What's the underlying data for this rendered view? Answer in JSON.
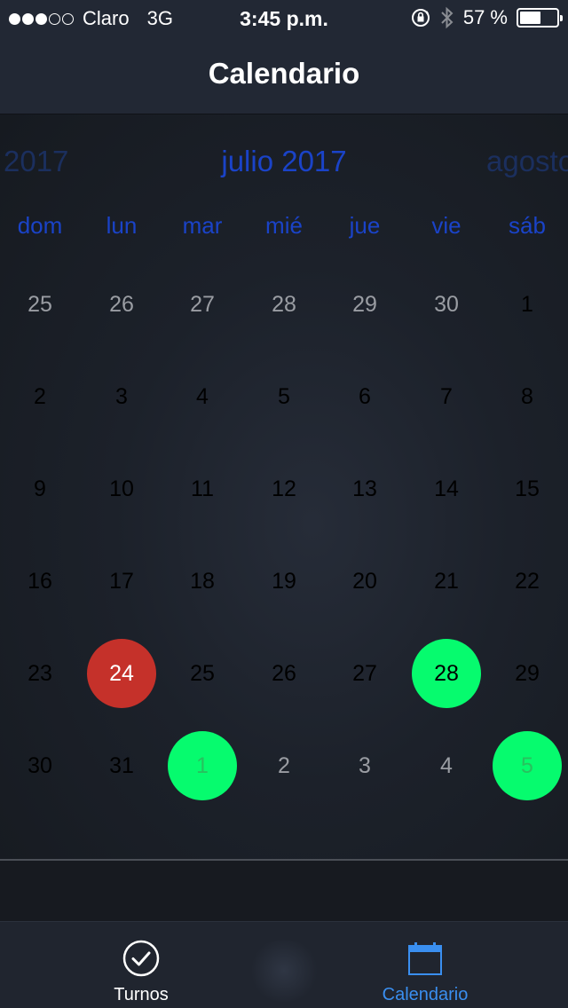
{
  "status_bar": {
    "signal_bars_filled": 3,
    "signal_bars_total": 5,
    "carrier": "Claro",
    "network": "3G",
    "time": "3:45 p.m.",
    "icons": [
      "orientation-lock-icon",
      "bluetooth-icon"
    ],
    "battery_percent_text": "57 %",
    "battery_level": 0.57
  },
  "nav": {
    "title": "Calendario"
  },
  "calendar": {
    "prev_month": "2017",
    "current_month": "julio 2017",
    "next_month": "agosto",
    "weekdays": [
      "dom",
      "lun",
      "mar",
      "mié",
      "jue",
      "vie",
      "sáb"
    ],
    "weeks": [
      [
        {
          "n": "25",
          "t": "outside"
        },
        {
          "n": "26",
          "t": "outside"
        },
        {
          "n": "27",
          "t": "outside"
        },
        {
          "n": "28",
          "t": "outside"
        },
        {
          "n": "29",
          "t": "outside"
        },
        {
          "n": "30",
          "t": "outside"
        },
        {
          "n": "1",
          "t": "normal"
        }
      ],
      [
        {
          "n": "2",
          "t": "normal"
        },
        {
          "n": "3",
          "t": "normal"
        },
        {
          "n": "4",
          "t": "normal"
        },
        {
          "n": "5",
          "t": "normal"
        },
        {
          "n": "6",
          "t": "normal"
        },
        {
          "n": "7",
          "t": "normal"
        },
        {
          "n": "8",
          "t": "normal"
        }
      ],
      [
        {
          "n": "9",
          "t": "normal"
        },
        {
          "n": "10",
          "t": "normal"
        },
        {
          "n": "11",
          "t": "normal"
        },
        {
          "n": "12",
          "t": "normal"
        },
        {
          "n": "13",
          "t": "normal"
        },
        {
          "n": "14",
          "t": "normal"
        },
        {
          "n": "15",
          "t": "normal"
        }
      ],
      [
        {
          "n": "16",
          "t": "normal"
        },
        {
          "n": "17",
          "t": "normal"
        },
        {
          "n": "18",
          "t": "normal"
        },
        {
          "n": "19",
          "t": "normal"
        },
        {
          "n": "20",
          "t": "normal"
        },
        {
          "n": "21",
          "t": "normal"
        },
        {
          "n": "22",
          "t": "normal"
        }
      ],
      [
        {
          "n": "23",
          "t": "normal"
        },
        {
          "n": "24",
          "t": "red"
        },
        {
          "n": "25",
          "t": "normal"
        },
        {
          "n": "26",
          "t": "normal"
        },
        {
          "n": "27",
          "t": "normal"
        },
        {
          "n": "28",
          "t": "green"
        },
        {
          "n": "29",
          "t": "normal"
        }
      ],
      [
        {
          "n": "30",
          "t": "normal"
        },
        {
          "n": "31",
          "t": "normal"
        },
        {
          "n": "1",
          "t": "green-dim"
        },
        {
          "n": "2",
          "t": "outside"
        },
        {
          "n": "3",
          "t": "outside"
        },
        {
          "n": "4",
          "t": "outside"
        },
        {
          "n": "5",
          "t": "green-dim"
        }
      ]
    ],
    "colors": {
      "accent_blue": "#1a43c8",
      "marked_red": "#c5312a",
      "marked_green": "#06fb6e"
    }
  },
  "tab_bar": {
    "tabs": [
      {
        "label": "Turnos",
        "icon": "checkmark-circle-icon",
        "selected": false
      },
      {
        "label": "Calendario",
        "icon": "calendar-icon",
        "selected": true
      }
    ],
    "selected_color": "#3a8ff0"
  }
}
